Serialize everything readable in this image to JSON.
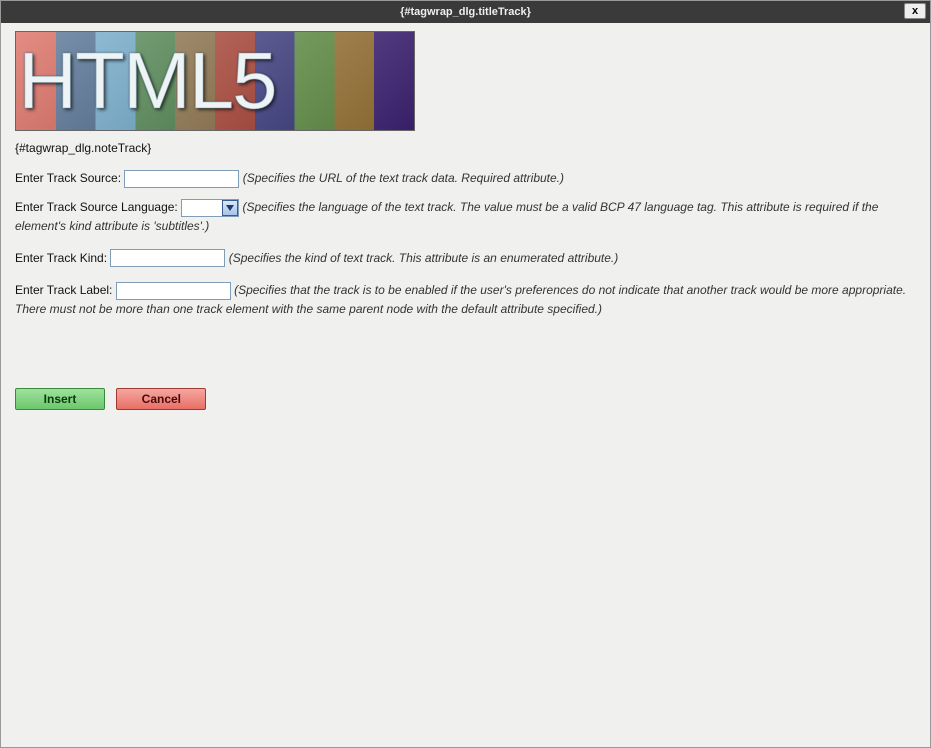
{
  "titlebar": {
    "title": "{#tagwrap_dlg.titleTrack}",
    "close_symbol": "x"
  },
  "banner": {
    "text": "HTML5"
  },
  "note": "{#tagwrap_dlg.noteTrack}",
  "fields": {
    "source": {
      "label": "Enter Track Source:",
      "value": "",
      "hint": "(Specifies the URL of the text track data. Required attribute.)"
    },
    "srclang": {
      "label": "Enter Track Source Language:",
      "value": "",
      "hint": "(Specifies the language of the text track. The value must be a valid BCP 47 language tag. This attribute is required if the element's kind attribute is 'subtitles'.)"
    },
    "kind": {
      "label": "Enter Track Kind:",
      "value": "",
      "hint": "(Specifies the kind of text track. This attribute is an enumerated attribute.)"
    },
    "label": {
      "label": "Enter Track Label:",
      "value": "",
      "hint": "(Specifies that the track is to be enabled if the user's preferences do not indicate that another track would be more appropriate. There must not be more than one track element with the same parent node with the default attribute specified.)"
    }
  },
  "buttons": {
    "insert": "Insert",
    "cancel": "Cancel"
  }
}
